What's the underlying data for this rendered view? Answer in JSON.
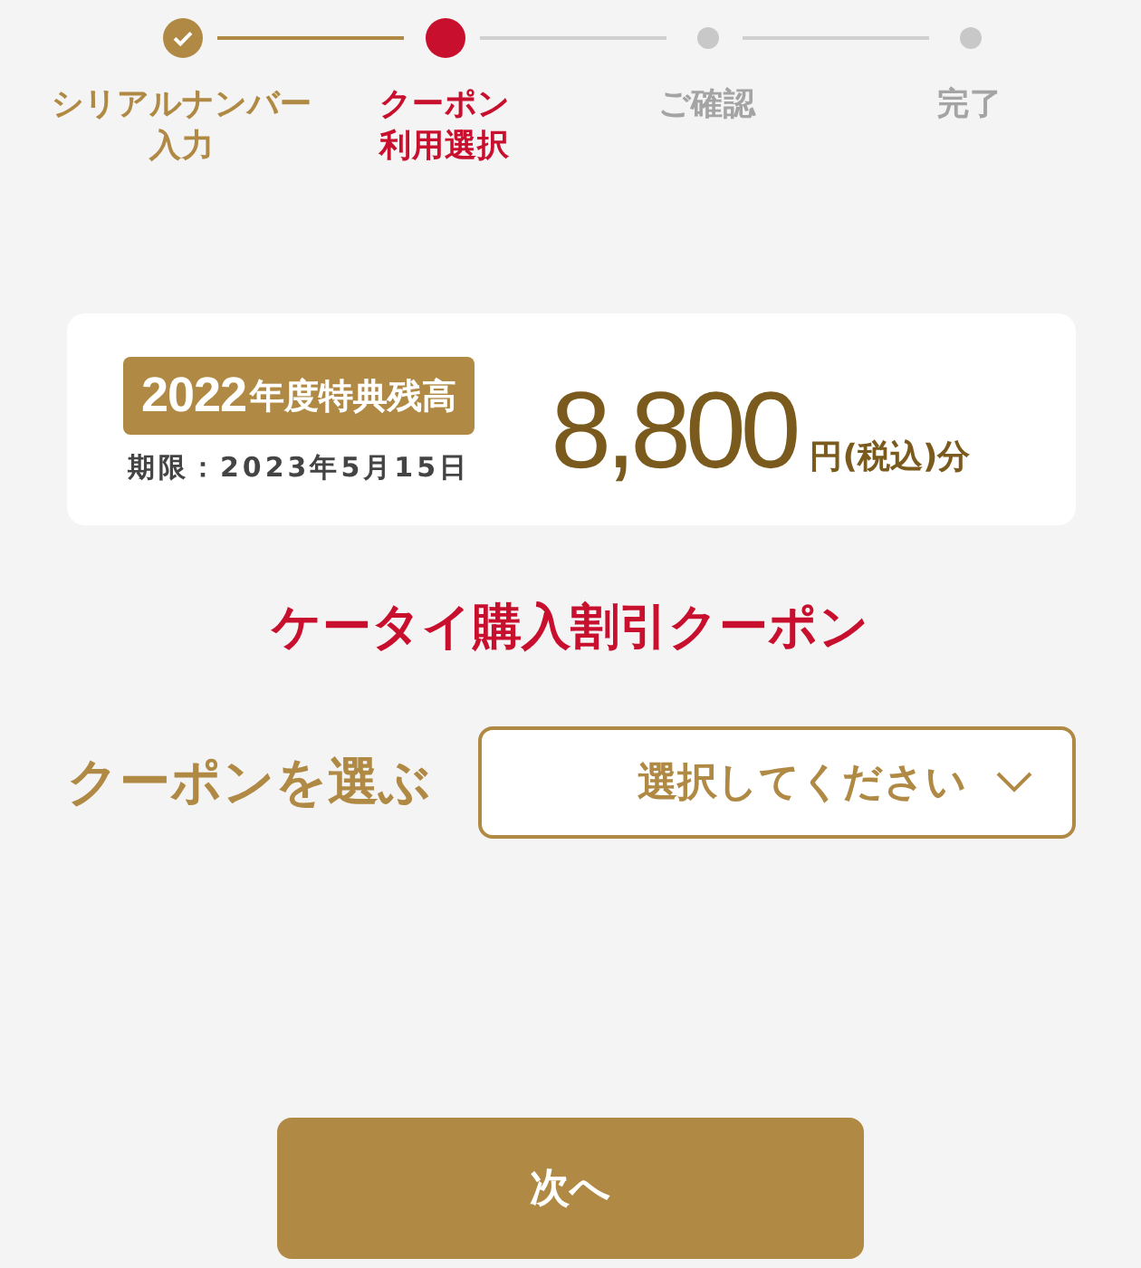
{
  "steps": [
    {
      "lines": [
        "シリアルナンバー",
        "入力"
      ],
      "completed": true,
      "selected": false
    },
    {
      "lines": [
        "クーポン",
        "利用選択"
      ],
      "completed": false,
      "selected": true
    },
    {
      "lines": [
        "ご確認"
      ],
      "completed": false,
      "selected": false
    },
    {
      "lines": [
        "完了"
      ],
      "completed": false,
      "selected": false
    }
  ],
  "balance": {
    "badge_year": "2022",
    "badge_label": "年度特典残高",
    "expiry": "期限：2023年5月15日",
    "amount": "8,800",
    "unit": "円(税込)分"
  },
  "coupon_title": "ケータイ購入割引クーポン",
  "coupon_select": {
    "label": "クーポンを選ぶ",
    "placeholder": "選択してください"
  },
  "next_button": "次へ"
}
